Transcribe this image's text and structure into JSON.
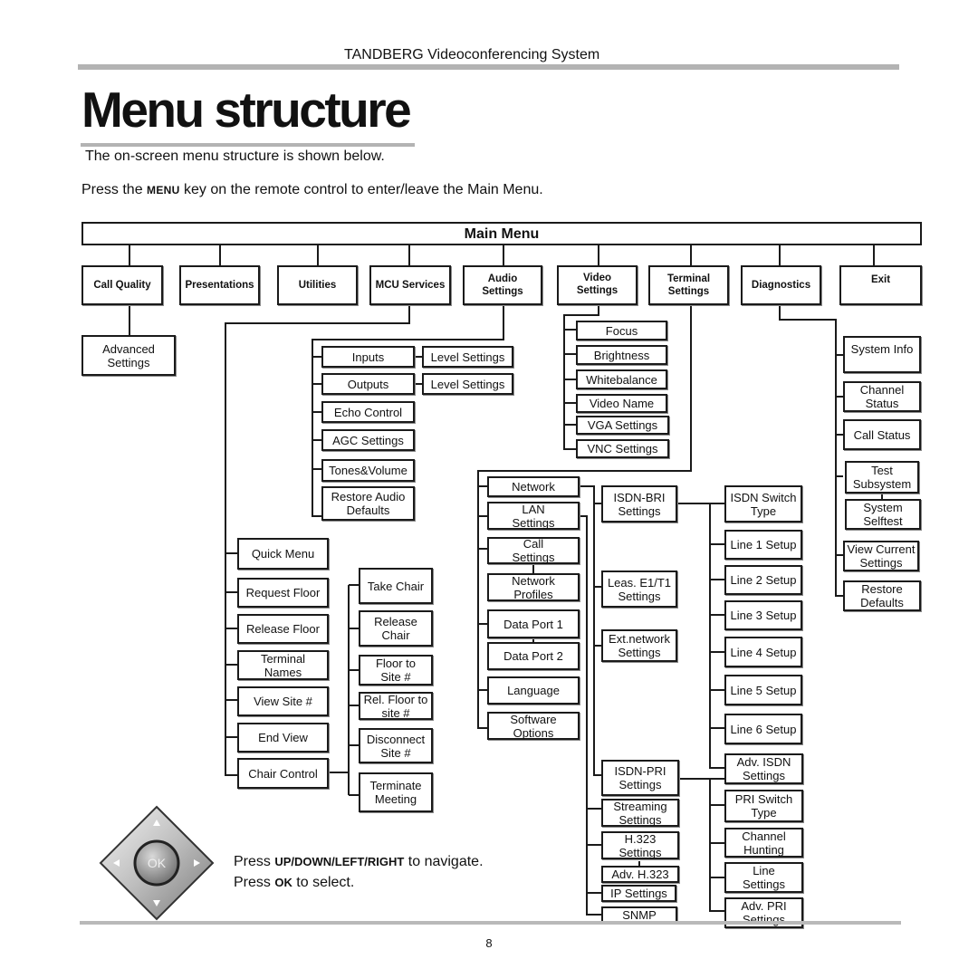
{
  "header": {
    "doc_title": "TANDBERG Videoconferencing System"
  },
  "page": {
    "title": "Menu structure",
    "intro": "The on-screen menu structure is shown below.",
    "instruction": {
      "before": "Press the ",
      "key": "Menu",
      "after": " key on the remote control to enter/leave the Main Menu."
    },
    "page_number": "8"
  },
  "diagram": {
    "root": "Main Menu",
    "top_level": {
      "call_quality": "Call Quality",
      "presentations": "Presentations",
      "utilities": "Utilities",
      "mcu_services": "MCU Services",
      "audio_settings": "Audio\nSettings",
      "video_settings": "Video\nSettings",
      "terminal_settings": "Terminal\nSettings",
      "diagnostics": "Diagnostics",
      "exit": "Exit"
    },
    "call_quality_children": [
      "Advanced\nSettings"
    ],
    "audio_children": {
      "inputs": "Inputs",
      "inputs_level": "Level Settings",
      "outputs": "Outputs",
      "outputs_level": "Level Settings",
      "echo_control": "Echo Control",
      "agc_settings": "AGC Settings",
      "tones_volume": "Tones&Volume",
      "restore_audio_defaults": "Restore Audio\nDefaults"
    },
    "video_children": [
      "Focus",
      "Brightness",
      "Whitebalance",
      "Video Name",
      "VGA Settings",
      "VNC Settings"
    ],
    "diagnostics_children": {
      "system_info": "System Info",
      "channel_status": "Channel\nStatus",
      "call_status": "Call Status",
      "test_subsystem": "Test\nSubsystem",
      "system_selftest": "System\nSelftest",
      "view_current_settings": "View Current\nSettings",
      "restore_defaults": "Restore\nDefaults"
    },
    "mcu_children": {
      "quick_menu": "Quick Menu",
      "request_floor": "Request Floor",
      "release_floor": "Release Floor",
      "terminal_names": "Terminal\nNames",
      "view_site": "View  Site #",
      "end_view": "End  View",
      "chair_control": "Chair Control"
    },
    "chair_control_children": {
      "take_chair": "Take Chair",
      "release_chair": "Release\nChair",
      "floor_to_site": "Floor to\nSite #",
      "rel_floor_to_site": "Rel. Floor to\nsite #",
      "disconnect_site": "Disconnect\nSite #",
      "terminate_meeting": "Terminate\nMeeting"
    },
    "terminal_children": {
      "network": "Network",
      "lan_settings": "LAN\nSettings",
      "call_settings": "Call\nSettings",
      "network_profiles": "Network\nProfiles",
      "data_port_1": "Data Port 1",
      "data_port_2": "Data Port 2",
      "language": "Language",
      "software_options": "Software\nOptions"
    },
    "network_children": {
      "isdn_bri": "ISDN-BRI\nSettings",
      "leased_e1t1": "Leas. E1/T1\nSettings",
      "ext_network": "Ext.network\nSettings"
    },
    "lan_children": {
      "isdn_pri": "ISDN-PRI\nSettings",
      "streaming": "Streaming\nSettings",
      "h323": "H.323\nSettings",
      "adv_h323": "Adv.  H.323",
      "ip_settings": "IP Settings",
      "snmp": "SNMP"
    },
    "isdn_bri_children": {
      "isdn_switch_type": "ISDN Switch\nType",
      "line1": "Line 1 Setup",
      "line2": "Line 2 Setup",
      "line3": "Line 3 Setup",
      "line4": "Line 4 Setup",
      "line5": "Line 5 Setup",
      "line6": "Line 6 Setup",
      "adv_isdn": "Adv. ISDN\nSettings"
    },
    "isdn_pri_children": {
      "pri_switch_type": "PRI Switch\nType",
      "channel_hunting": "Channel\nHunting",
      "line_settings": "Line\nSettings",
      "adv_pri": "Adv. PRI\nSettings"
    }
  },
  "remote": {
    "ok_label": "OK",
    "icon_names": [
      "up-arrow-icon",
      "down-arrow-icon",
      "left-arrow-icon",
      "right-arrow-icon"
    ]
  },
  "navigation_help": {
    "line1_before": "Press ",
    "keys": "Up/Down/Left/Right",
    "line1_after": " to navigate.",
    "line2_before": "Press ",
    "ok_key": "Ok",
    "line2_after": " to select."
  }
}
